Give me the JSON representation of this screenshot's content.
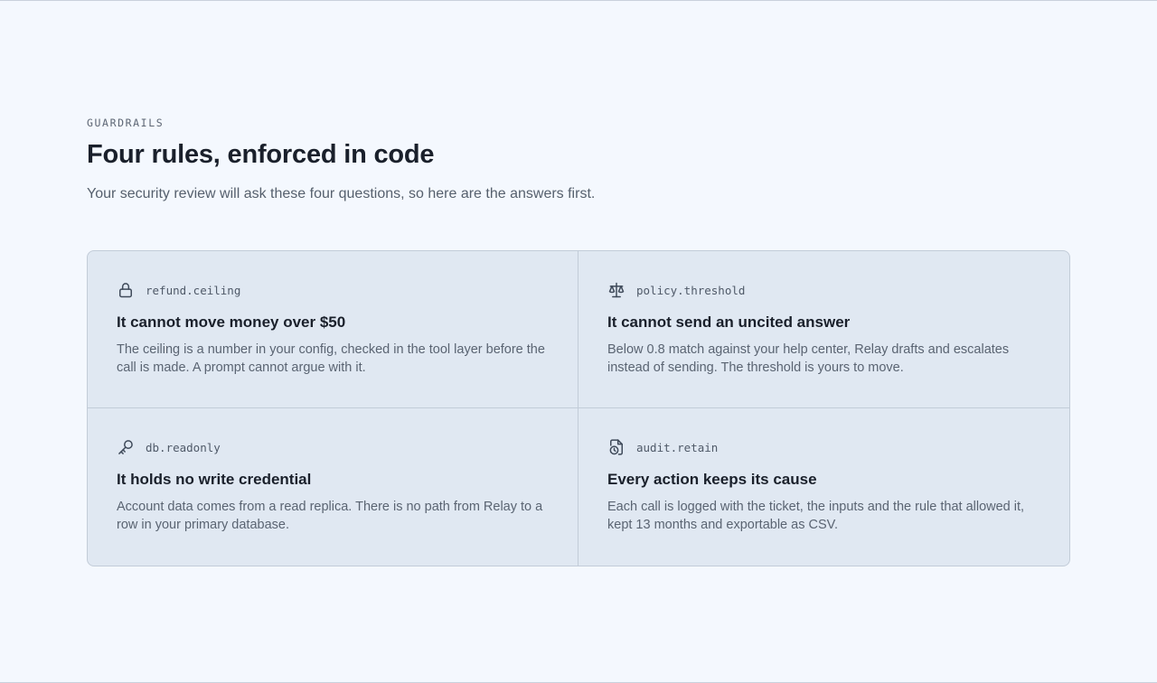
{
  "header": {
    "eyebrow": "GUARDRAILS",
    "title": "Four rules, enforced in code",
    "subtitle": "Your security review will ask these four questions, so here are the answers first."
  },
  "rules": [
    {
      "icon": "lock-icon",
      "key": "refund.ceiling",
      "title": "It cannot move money over $50",
      "body": "The ceiling is a number in your config, checked in the tool layer before the call is made. A prompt cannot argue with it."
    },
    {
      "icon": "scale-icon",
      "key": "policy.threshold",
      "title": "It cannot send an uncited answer",
      "body": "Below 0.8 match against your help center, Relay drafts and escalates instead of sending. The threshold is yours to move."
    },
    {
      "icon": "key-icon",
      "key": "db.readonly",
      "title": "It holds no write credential",
      "body": "Account data comes from a read replica. There is no path from Relay to a row in your primary database."
    },
    {
      "icon": "file-clock-icon",
      "key": "audit.retain",
      "title": "Every action keeps its cause",
      "body": "Each call is logged with the ticket, the inputs and the rule that allowed it, kept 13 months and exportable as CSV."
    }
  ],
  "colors": {
    "background": "#f4f8fe",
    "card": "#e0e8f2",
    "border": "#c2ccd8",
    "icon": "#3f4a5a"
  }
}
